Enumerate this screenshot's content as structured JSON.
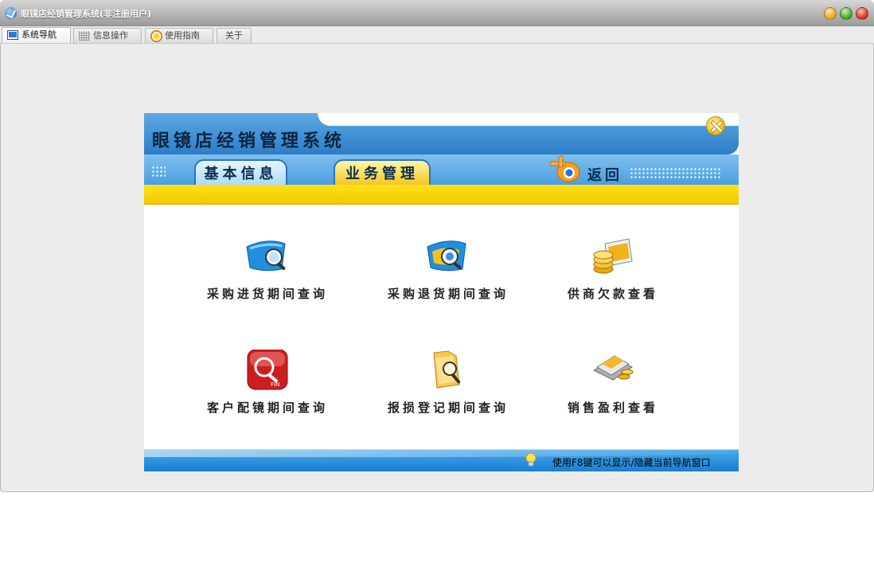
{
  "window": {
    "title": "眼镜店经销管理系统(非注册用户)"
  },
  "tabs": [
    {
      "label": "系统导航",
      "icon": "monitor-icon",
      "active": true
    },
    {
      "label": "信息操作",
      "icon": "grid-icon",
      "active": false
    },
    {
      "label": "使用指南",
      "icon": "help-icon",
      "active": false
    },
    {
      "label": "关于",
      "icon": "",
      "active": false
    }
  ],
  "panel": {
    "system_title": "眼镜店经销管理系统",
    "tabs": [
      {
        "label": "基本信息",
        "active": false
      },
      {
        "label": "业务管理",
        "active": true
      }
    ],
    "back_label": "返回",
    "items": [
      {
        "label": "采购进货期间查询",
        "icon": "search-folder-icon"
      },
      {
        "label": "采购退货期间查询",
        "icon": "search-return-icon"
      },
      {
        "label": "供商欠款查看",
        "icon": "coins-icon"
      },
      {
        "label": "客户配镜期间查询",
        "icon": "find-icon"
      },
      {
        "label": "报损登记期间查询",
        "icon": "folder-search-icon"
      },
      {
        "label": "销售盈利查看",
        "icon": "money-icon"
      }
    ],
    "footer_tip": "使用F8键可以显示/隐藏当前导航窗口"
  },
  "colors": {
    "panel_blue": "#2d7dc7",
    "strip_yellow": "#f2c800"
  }
}
